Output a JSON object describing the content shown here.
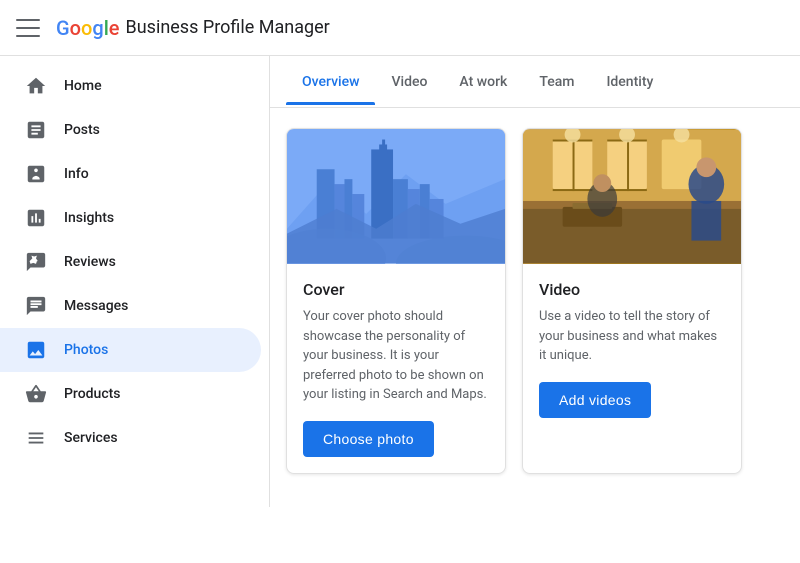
{
  "header": {
    "menu_label": "Menu",
    "app_name": "Business Profile Manager",
    "google": {
      "G": "G",
      "o1": "o",
      "o2": "o",
      "g": "g",
      "l": "l",
      "e": "e"
    }
  },
  "sidebar": {
    "items": [
      {
        "id": "home",
        "label": "Home",
        "icon": "home-icon",
        "active": false
      },
      {
        "id": "posts",
        "label": "Posts",
        "icon": "posts-icon",
        "active": false
      },
      {
        "id": "info",
        "label": "Info",
        "icon": "info-icon",
        "active": false
      },
      {
        "id": "insights",
        "label": "Insights",
        "icon": "insights-icon",
        "active": false
      },
      {
        "id": "reviews",
        "label": "Reviews",
        "icon": "reviews-icon",
        "active": false
      },
      {
        "id": "messages",
        "label": "Messages",
        "icon": "messages-icon",
        "active": false
      },
      {
        "id": "photos",
        "label": "Photos",
        "icon": "photos-icon",
        "active": true
      },
      {
        "id": "products",
        "label": "Products",
        "icon": "products-icon",
        "active": false
      },
      {
        "id": "services",
        "label": "Services",
        "icon": "services-icon",
        "active": false
      }
    ]
  },
  "tabs": [
    {
      "id": "overview",
      "label": "Overview",
      "active": true
    },
    {
      "id": "video",
      "label": "Video",
      "active": false
    },
    {
      "id": "at-work",
      "label": "At work",
      "active": false
    },
    {
      "id": "team",
      "label": "Team",
      "active": false
    },
    {
      "id": "identity",
      "label": "Identity",
      "active": false
    }
  ],
  "cards": [
    {
      "id": "cover",
      "title": "Cover",
      "description": "Your cover photo should showcase the personality of your business. It is your preferred photo to be shown on your listing in Search and Maps.",
      "button_label": "Choose photo",
      "type": "cover"
    },
    {
      "id": "video",
      "title": "Video",
      "description": "Use a video to tell the story of your business and what makes it unique.",
      "button_label": "Add videos",
      "type": "video"
    }
  ]
}
